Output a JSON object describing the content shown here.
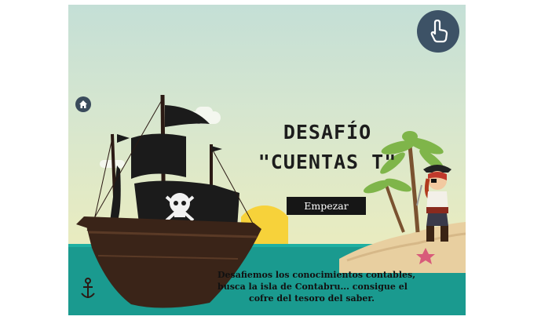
{
  "title": {
    "line1": "DESAFÍO",
    "line2": "\"CUENTAS T\""
  },
  "start_button": {
    "label": "Empezar"
  },
  "description": {
    "lines": [
      "Desafiemos los conocimientos contables,",
      "busca la isla de Contabru... consigue el",
      "cofre del tesoro del saber."
    ]
  },
  "icons": {
    "home": "home-icon",
    "touch": "hand-pointer-icon"
  },
  "colors": {
    "sky": "#c4dfd6",
    "sea": "#1a9a8f",
    "button": "#161616",
    "round_button": "#3d5266"
  }
}
